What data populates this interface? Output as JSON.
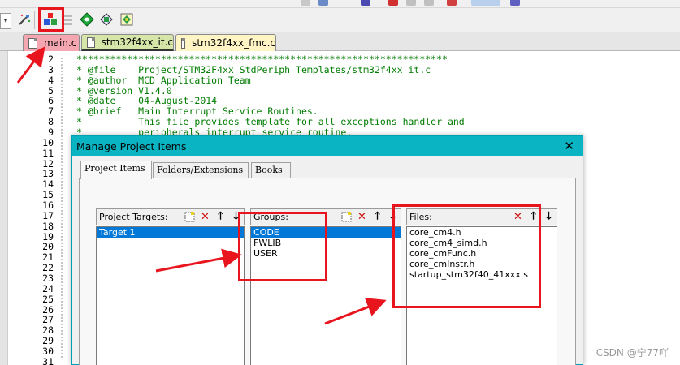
{
  "tabs": [
    {
      "label": "main.c",
      "color": "#f4a7b0"
    },
    {
      "label": "stm32f4xx_it.c",
      "color": "#d6e6a8"
    },
    {
      "label": "stm32f4xx_fmc.c",
      "color": "#fff4c4"
    }
  ],
  "editor": {
    "line_numbers": [
      "2",
      "3",
      "4",
      "5",
      "6",
      "7",
      "8",
      "9",
      "10",
      "11",
      "12",
      "13",
      "14",
      "15",
      "16",
      "17",
      "18",
      "19",
      "20",
      "21",
      "22",
      "23",
      "24",
      "25",
      "26",
      "27",
      "28",
      "29",
      "30",
      "31"
    ],
    "code_lines": [
      "******************************************************************",
      "* @file    Project/STM32F4xx_StdPeriph_Templates/stm32f4xx_it.c",
      "* @author  MCD Application Team",
      "* @version V1.4.0",
      "* @date    04-August-2014",
      "* @brief   Main Interrupt Service Routines.",
      "*          This file provides template for all exceptions handler and",
      "*          peripherals interrupt service routine."
    ]
  },
  "dialog": {
    "title": "Manage Project Items",
    "close_symbol": "✕",
    "tabs": [
      "Project Items",
      "Folders/Extensions",
      "Books"
    ],
    "targets": {
      "label": "Project Targets:",
      "items": [
        "Target 1"
      ],
      "selected": 0
    },
    "groups": {
      "label": "Groups:",
      "items": [
        "CODE",
        "FWLIB",
        "USER"
      ],
      "selected": 0
    },
    "files": {
      "label": "Files:",
      "items": [
        "core_cm4.h",
        "core_cm4_simd.h",
        "core_cmFunc.h",
        "core_cmInstr.h",
        "startup_stm32f40_41xxx.s"
      ]
    }
  },
  "watermark": "CSDN @宁77吖",
  "colors": {
    "annotation_red": "#e8141e",
    "titlebar": "#0ab4c3",
    "selection": "#0078d7",
    "comment_green": "#007c00"
  }
}
